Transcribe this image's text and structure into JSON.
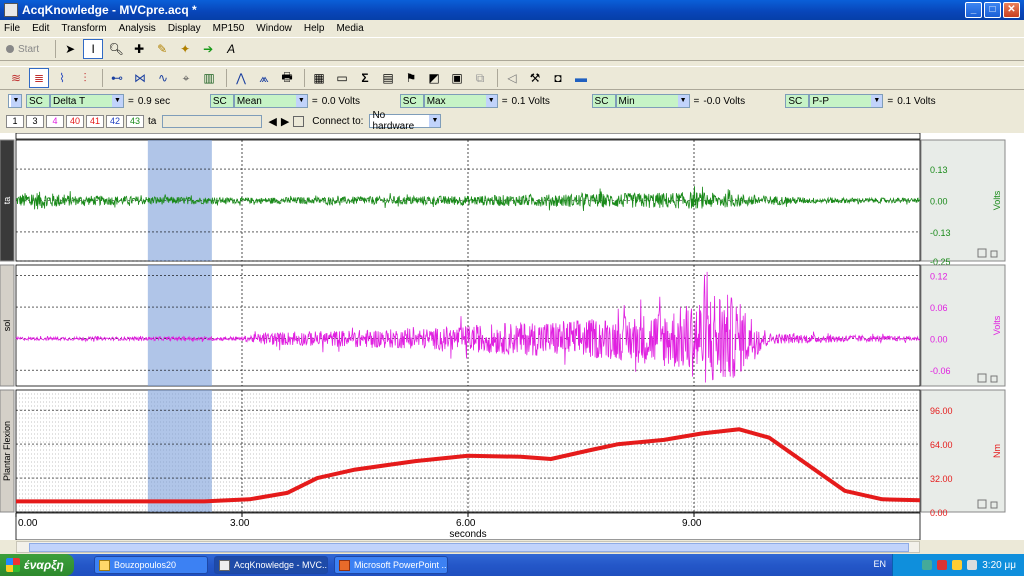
{
  "window": {
    "title": "AcqKnowledge - MVCpre.acq *"
  },
  "menu": [
    "File",
    "Edit",
    "Transform",
    "Analysis",
    "Display",
    "MP150",
    "Window",
    "Help",
    "Media"
  ],
  "toolbar": {
    "start_label": "Start"
  },
  "measurements": [
    {
      "channel": "SC",
      "type": "Delta T",
      "value": "0.9 sec"
    },
    {
      "channel": "SC",
      "type": "Mean",
      "value": "0.0 Volts"
    },
    {
      "channel": "SC",
      "type": "Max",
      "value": "0.1 Volts"
    },
    {
      "channel": "SC",
      "type": "Min",
      "value": "-0.0 Volts"
    },
    {
      "channel": "SC",
      "type": "P-P",
      "value": "0.1 Volts"
    }
  ],
  "channel_bar": {
    "buttons": [
      "1",
      "3",
      "4",
      "40",
      "41",
      "42",
      "43"
    ],
    "current_label": "ta",
    "connect_label": "Connect to:",
    "connect_value": "No hardware"
  },
  "chart_data": {
    "type": "line",
    "xlabel": "seconds",
    "x_ticks": [
      "0.00",
      "3.00",
      "6.00",
      "9.00"
    ],
    "xlim": [
      0,
      12
    ],
    "selection": [
      1.75,
      2.6
    ],
    "channels": [
      {
        "label": "ta",
        "units": "Volts",
        "color": "#1a8a1a",
        "ticks": [
          "0.13",
          "0.00",
          "-0.13",
          "-0.25"
        ],
        "ylim": [
          -0.25,
          0.25
        ],
        "envelope": [
          [
            0,
            0.02
          ],
          [
            0.2,
            0.04
          ],
          [
            0.8,
            0.02
          ],
          [
            1.1,
            0.02
          ],
          [
            3,
            0.012
          ],
          [
            6,
            0.02
          ],
          [
            8,
            0.03
          ],
          [
            9,
            0.035
          ],
          [
            10,
            0.02
          ],
          [
            10.5,
            0.012
          ],
          [
            12,
            0.01
          ]
        ]
      },
      {
        "label": "sol",
        "units": "Volts",
        "color": "#e020e0",
        "ticks": [
          "0.12",
          "0.06",
          "0.00",
          "-0.06"
        ],
        "ylim": [
          -0.09,
          0.14
        ],
        "envelope": [
          [
            0,
            0.003
          ],
          [
            3,
            0.004
          ],
          [
            3.3,
            0.012
          ],
          [
            5.5,
            0.02
          ],
          [
            6.5,
            0.03
          ],
          [
            8,
            0.04
          ],
          [
            8.8,
            0.06
          ],
          [
            9.3,
            0.1
          ],
          [
            9.6,
            0.07
          ],
          [
            10,
            0.01
          ],
          [
            12,
            0.004
          ]
        ]
      },
      {
        "label": "Plantar Flexion",
        "units": "Nm",
        "color": "#e51b1b",
        "ticks": [
          "96.00",
          "64.00",
          "32.00",
          "0.00"
        ],
        "ylim": [
          0,
          115
        ],
        "points": [
          [
            0,
            10
          ],
          [
            1.5,
            10
          ],
          [
            2.5,
            10
          ],
          [
            3.1,
            12
          ],
          [
            3.6,
            18
          ],
          [
            4.0,
            32
          ],
          [
            4.5,
            40
          ],
          [
            5.3,
            48
          ],
          [
            6.0,
            53
          ],
          [
            6.7,
            52
          ],
          [
            7.1,
            50
          ],
          [
            7.6,
            58
          ],
          [
            8.0,
            64
          ],
          [
            8.6,
            68
          ],
          [
            9.1,
            74
          ],
          [
            9.6,
            78
          ],
          [
            10.0,
            70
          ],
          [
            10.5,
            45
          ],
          [
            11.0,
            20
          ],
          [
            11.5,
            12
          ],
          [
            12.0,
            11
          ]
        ]
      }
    ]
  },
  "taskbar": {
    "start_label": "έναρξη",
    "tasks": [
      "Bouzopoulos20",
      "AcqKnowledge - MVC...",
      "Microsoft PowerPoint ..."
    ],
    "lang": "EN",
    "clock": "3:20 μμ"
  }
}
